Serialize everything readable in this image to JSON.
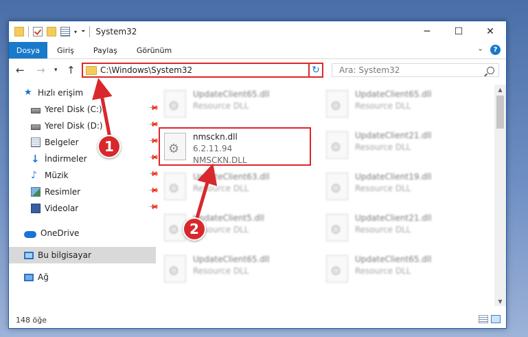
{
  "window": {
    "title": "System32"
  },
  "ribbon": {
    "file_tab": "Dosya",
    "tabs": [
      "Giriş",
      "Paylaş",
      "Görünüm"
    ]
  },
  "address": {
    "path": "C:\\Windows\\System32"
  },
  "search": {
    "placeholder": "Ara: System32"
  },
  "sidebar": {
    "quick_access": "Hızlı erişim",
    "items": [
      "Yerel Disk (C:)",
      "Yerel Disk (D:)",
      "Belgeler",
      "İndirmeler",
      "Müzik",
      "Resimler",
      "Videolar"
    ],
    "onedrive": "OneDrive",
    "this_pc": "Bu bilgisayar",
    "network": "Ağ"
  },
  "files": {
    "left": [
      {
        "name": "UpdateClient65.dll",
        "type": "Resource DLL"
      },
      {
        "name": "nmsckn.dll",
        "version": "6.2.11.94",
        "desc": "NMSCKN.DLL"
      },
      {
        "name": "UpdateClient63.dll",
        "type": "Resource DLL"
      },
      {
        "name": "UpdateClient5.dll",
        "type": "Resource DLL"
      },
      {
        "name": "UpdateClient65.dll",
        "type": "Resource DLL"
      }
    ],
    "right": [
      {
        "name": "UpdateClient65.dll",
        "type": "Resource DLL"
      },
      {
        "name": "UpdateClient21.dll",
        "type": "Resource DLL"
      },
      {
        "name": "UpdateClient19.dll",
        "type": "Resource DLL"
      },
      {
        "name": "UpdateClient21.dll",
        "type": "Resource DLL"
      },
      {
        "name": "UpdateClient65.dll",
        "type": "Resource DLL"
      }
    ]
  },
  "status": {
    "count": "148 öğe"
  },
  "annotations": {
    "step1": "1",
    "step2": "2"
  },
  "colors": {
    "highlight": "#e0242b",
    "accent": "#1979ca",
    "badge": "#d8282d"
  }
}
